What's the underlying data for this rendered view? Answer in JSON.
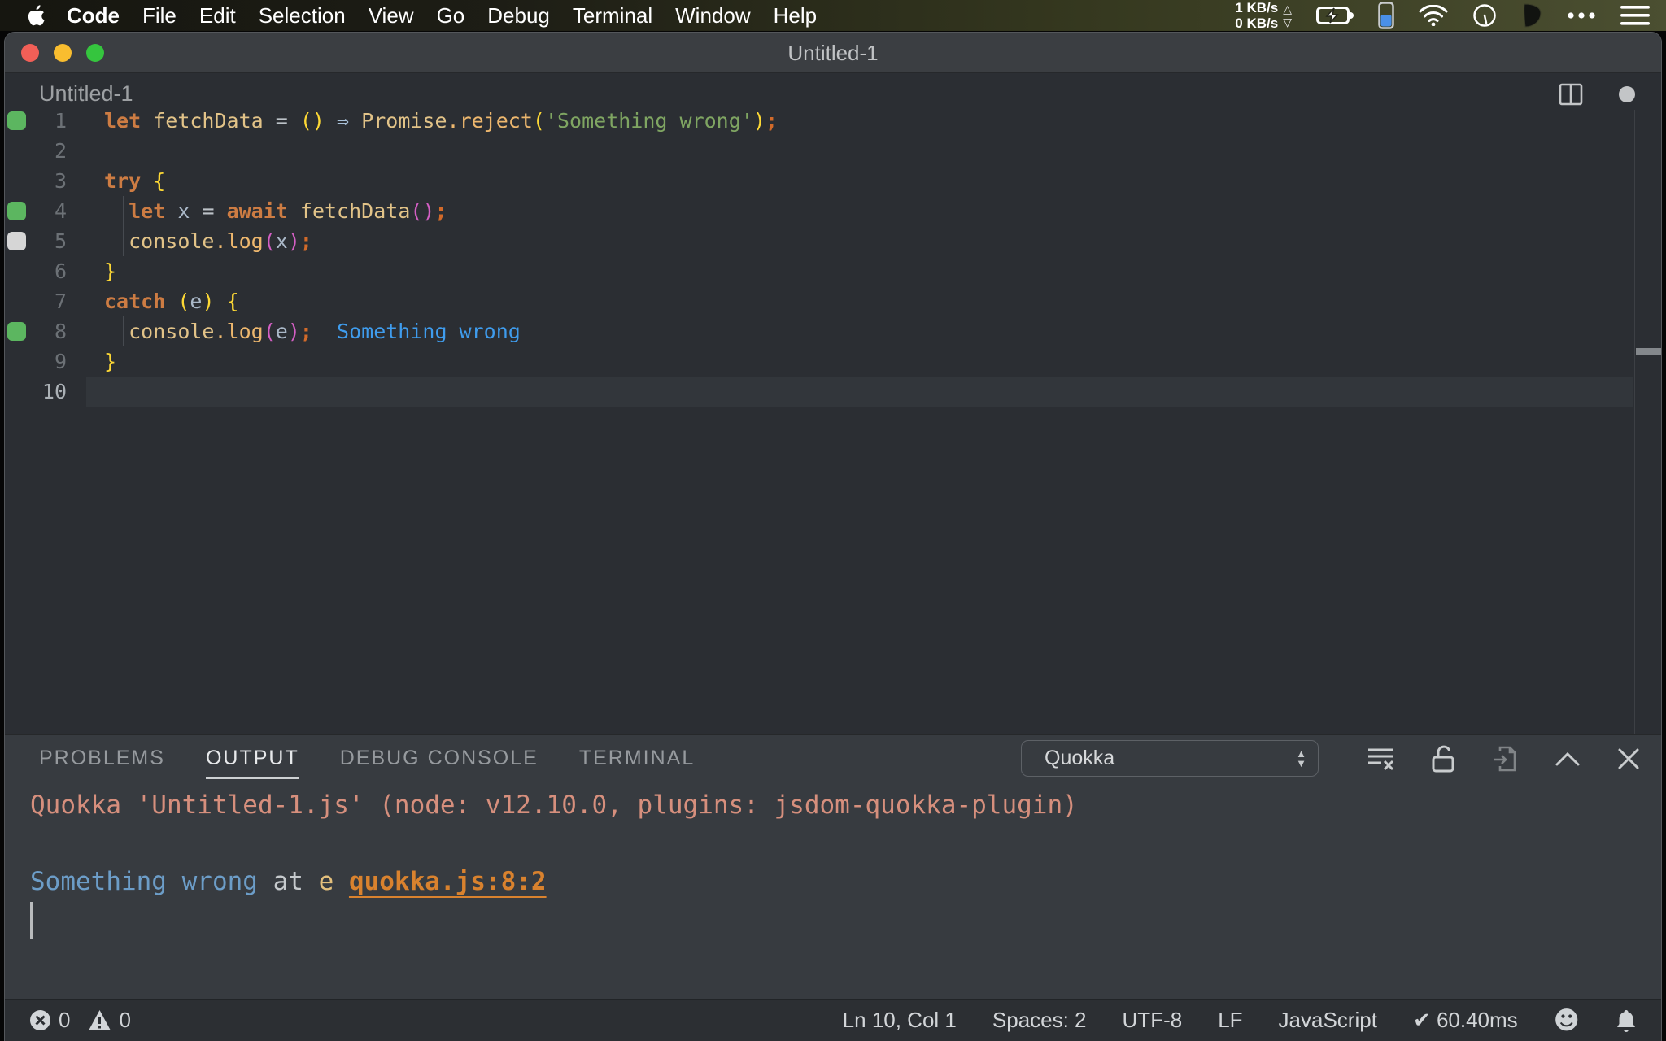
{
  "menu_bar": {
    "apple_icon": "apple-logo",
    "items": [
      {
        "label": "Code",
        "bold": true
      },
      {
        "label": "File"
      },
      {
        "label": "Edit"
      },
      {
        "label": "Selection"
      },
      {
        "label": "View"
      },
      {
        "label": "Go"
      },
      {
        "label": "Debug"
      },
      {
        "label": "Terminal"
      },
      {
        "label": "Window"
      },
      {
        "label": "Help"
      }
    ],
    "status": {
      "up_speed": "1 KB/s",
      "down_speed": "0 KB/s",
      "up_arrow": "△",
      "down_arrow": "▽",
      "icons": [
        "battery-charging",
        "device-battery",
        "wifi",
        "gauge",
        "pointer-shield",
        "ellipsis",
        "list-menu"
      ]
    }
  },
  "window": {
    "title": "Untitled-1"
  },
  "editor": {
    "tab_title": "Untitled-1",
    "action_icons": [
      "split-editor",
      "modified-indicator"
    ],
    "lines": [
      {
        "num": "1",
        "marker": "green",
        "tokens": [
          {
            "t": "let",
            "c": "kw"
          },
          {
            "t": " ",
            "c": "pl"
          },
          {
            "t": "fetchData",
            "c": "id"
          },
          {
            "t": " ",
            "c": "pl"
          },
          {
            "t": "=",
            "c": "op"
          },
          {
            "t": " ",
            "c": "pl"
          },
          {
            "t": "()",
            "c": "p1"
          },
          {
            "t": " ",
            "c": "pl"
          },
          {
            "t": "⇒",
            "c": "arrow"
          },
          {
            "t": " ",
            "c": "pl"
          },
          {
            "t": "Promise",
            "c": "id"
          },
          {
            "t": ".reject",
            "c": "fn"
          },
          {
            "t": "(",
            "c": "p1"
          },
          {
            "t": "'Something wrong'",
            "c": "str"
          },
          {
            "t": ")",
            "c": "p1"
          },
          {
            "t": ";",
            "c": "semi"
          }
        ]
      },
      {
        "num": "2",
        "tokens": []
      },
      {
        "num": "3",
        "tokens": [
          {
            "t": "try",
            "c": "kw"
          },
          {
            "t": " ",
            "c": "pl"
          },
          {
            "t": "{",
            "c": "p1"
          }
        ]
      },
      {
        "num": "4",
        "marker": "green",
        "tokens": [
          {
            "t": "  ",
            "c": "pl"
          },
          {
            "t": "let",
            "c": "kw"
          },
          {
            "t": " ",
            "c": "pl"
          },
          {
            "t": "x",
            "c": "var"
          },
          {
            "t": " ",
            "c": "pl"
          },
          {
            "t": "=",
            "c": "op"
          },
          {
            "t": " ",
            "c": "pl"
          },
          {
            "t": "await",
            "c": "kw"
          },
          {
            "t": " ",
            "c": "pl"
          },
          {
            "t": "fetchData",
            "c": "id"
          },
          {
            "t": "()",
            "c": "p2"
          },
          {
            "t": ";",
            "c": "semi"
          }
        ]
      },
      {
        "num": "5",
        "marker": "gray",
        "tokens": [
          {
            "t": "  ",
            "c": "pl"
          },
          {
            "t": "console",
            "c": "id"
          },
          {
            "t": ".log",
            "c": "fn"
          },
          {
            "t": "(",
            "c": "p2"
          },
          {
            "t": "x",
            "c": "var"
          },
          {
            "t": ")",
            "c": "p2"
          },
          {
            "t": ";",
            "c": "semi"
          }
        ]
      },
      {
        "num": "6",
        "tokens": [
          {
            "t": "}",
            "c": "p1"
          }
        ]
      },
      {
        "num": "7",
        "tokens": [
          {
            "t": "catch",
            "c": "kw"
          },
          {
            "t": " ",
            "c": "pl"
          },
          {
            "t": "(",
            "c": "p1"
          },
          {
            "t": "e",
            "c": "var"
          },
          {
            "t": ")",
            "c": "p1"
          },
          {
            "t": " ",
            "c": "pl"
          },
          {
            "t": "{",
            "c": "p1"
          }
        ]
      },
      {
        "num": "8",
        "marker": "green",
        "tokens": [
          {
            "t": "  ",
            "c": "pl"
          },
          {
            "t": "console",
            "c": "id"
          },
          {
            "t": ".log",
            "c": "fn"
          },
          {
            "t": "(",
            "c": "p2"
          },
          {
            "t": "e",
            "c": "var"
          },
          {
            "t": ")",
            "c": "p2"
          },
          {
            "t": ";",
            "c": "semi"
          },
          {
            "t": "  ",
            "c": "pl"
          },
          {
            "t": "Something wrong",
            "c": "log"
          }
        ]
      },
      {
        "num": "9",
        "tokens": [
          {
            "t": "}",
            "c": "p1"
          }
        ]
      },
      {
        "num": "10",
        "active": true,
        "tokens": []
      }
    ]
  },
  "panel": {
    "tabs": [
      {
        "label": "PROBLEMS"
      },
      {
        "label": "OUTPUT",
        "active": true
      },
      {
        "label": "DEBUG CONSOLE"
      },
      {
        "label": "TERMINAL"
      }
    ],
    "channel_select": {
      "value": "Quokka",
      "arrow_up": "▲",
      "arrow_down": "▼"
    },
    "action_icons": [
      "clear-output",
      "unlock",
      "open-in-editor",
      "maximize-panel",
      "close-panel"
    ],
    "output_lines": [
      {
        "tokens": [
          {
            "t": "Quokka 'Untitled-1.js' (node: v12.10.0, plugins: jsdom-quokka-plugin)",
            "c": "salmon"
          }
        ]
      },
      {
        "tokens": []
      },
      {
        "tokens": [
          {
            "t": "Something wrong",
            "c": "oblue"
          },
          {
            "t": " at ",
            "c": "oplain"
          },
          {
            "t": "e ",
            "c": "okhaki"
          },
          {
            "t": "quokka.js:8:2",
            "c": "olink"
          }
        ]
      }
    ]
  },
  "status_bar": {
    "left": [
      {
        "icon": "errors",
        "count": "0"
      },
      {
        "icon": "warnings",
        "count": "0"
      }
    ],
    "right": [
      {
        "label": "Ln 10, Col 1"
      },
      {
        "label": "Spaces: 2"
      },
      {
        "label": "UTF-8"
      },
      {
        "label": "LF"
      },
      {
        "label": "JavaScript"
      },
      {
        "label": "60.40ms",
        "prefix": "✔ "
      }
    ],
    "icons": [
      "feedback-smiley",
      "notifications-bell"
    ],
    "smiley_glyph": "☻"
  },
  "colors": {
    "window_bg": "#2b2e33",
    "titlebar_bg": "#3b3e42",
    "panel_bg": "#373b40",
    "statusbar_bg": "#2c2f33",
    "line_highlight": "#32363b",
    "tl_red": "#f25f57",
    "tl_yellow": "#f9bd2f",
    "tl_green": "#35c53e",
    "marker_green": "#5cb660",
    "marker_gray": "#d6d6d6",
    "linenum": "#6c7176",
    "linenum_active": "#abb1b6",
    "kw": "#cd7c43",
    "id": "#e2c388",
    "fn": "#edb76e",
    "vr": "#aab8c8",
    "op": "#bcc2c8",
    "arrow": "#a9c1d9",
    "p1": "#fdd835",
    "p2": "#d45fc4",
    "str": "#7fa562",
    "semi": "#d26a2a",
    "pl": "#c5cad0",
    "log": "#3f9ced",
    "tab_inactive": "#969a9e",
    "tab_active": "#e7e9eb",
    "out_salmon": "#d68f7d",
    "out_blue": "#6c9dc8",
    "out_plain": "#c6cacd",
    "out_khaki": "#e4c07c",
    "out_link": "#d9822e",
    "status_text": "#d2d5d8"
  }
}
